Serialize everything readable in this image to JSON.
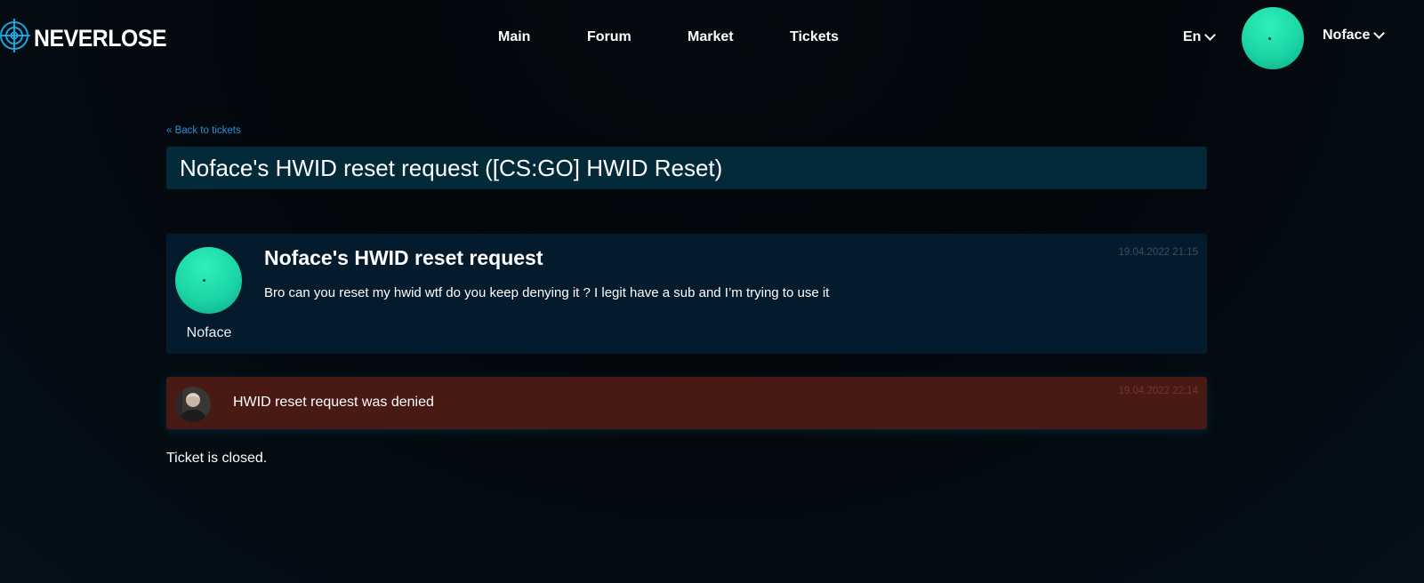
{
  "header": {
    "logo_text": "NEVERLOSE",
    "nav": [
      {
        "label": "Main"
      },
      {
        "label": "Forum"
      },
      {
        "label": "Market"
      },
      {
        "label": "Tickets"
      }
    ],
    "language": "En",
    "username": "Noface"
  },
  "ticket": {
    "back_link": "« Back to tickets",
    "title": "Noface's HWID reset request ([CS:GO] HWID Reset)",
    "post": {
      "author": "Noface",
      "heading": "Noface's HWID reset request",
      "body": "Bro can you reset my hwid wtf do you keep denying it ? I legit have a sub and I’m trying to use it",
      "timestamp": "19.04.2022 21:15"
    },
    "status_message": {
      "text": "HWID reset request was denied",
      "timestamp": "19.04.2022 22:14"
    },
    "closed_note": "Ticket is closed."
  },
  "colors": {
    "accent_link": "#2a8fd0",
    "title_bar_bg": "#022a39",
    "post_bg": "#041a2d",
    "denied_bg": "#491913",
    "avatar_green": "#1bd6a6"
  }
}
